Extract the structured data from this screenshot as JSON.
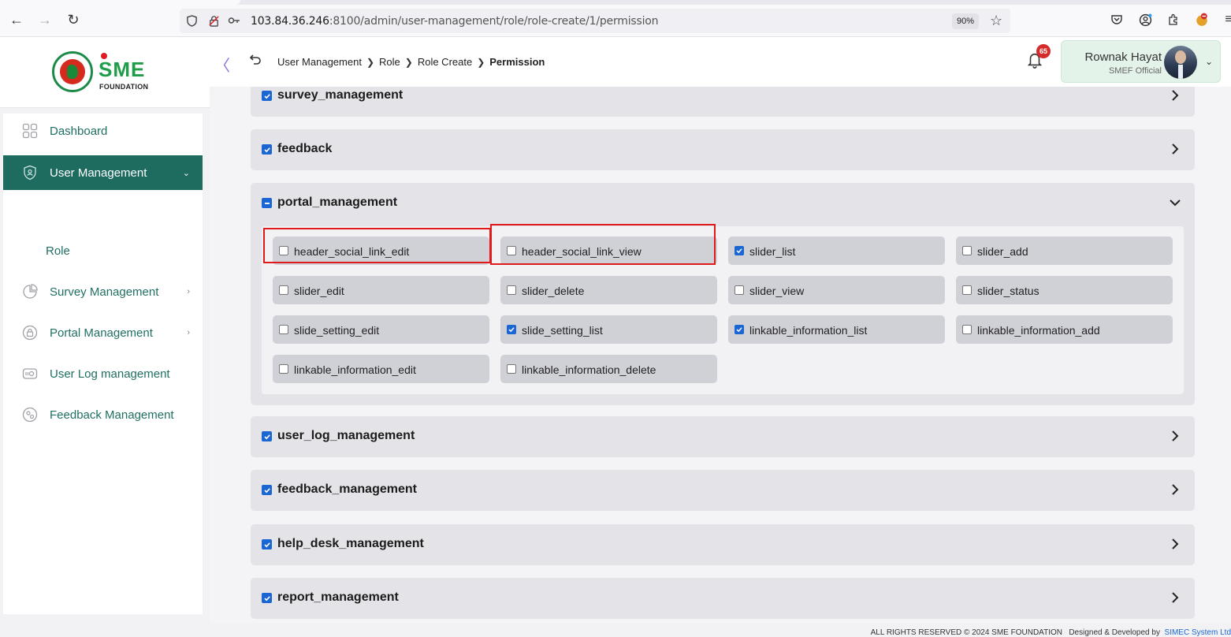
{
  "browser": {
    "url_host": "103.84.36.246",
    "url_rest": ":8100/admin/user-management/role/role-create/1/permission",
    "zoom": "90%"
  },
  "logo": {
    "brand": "SME",
    "subtitle": "FOUNDATION"
  },
  "sidebar": {
    "items": [
      {
        "label": "Dashboard",
        "icon": "grid-icon"
      },
      {
        "label": "User Management",
        "icon": "shield-user-icon",
        "active": true
      },
      {
        "label": "Survey Management",
        "icon": "pie-chart-icon"
      },
      {
        "label": "Portal Management",
        "icon": "lock-icon"
      },
      {
        "label": "User Log management",
        "icon": "log-icon"
      },
      {
        "label": "Feedback Management",
        "icon": "feedback-icon"
      }
    ],
    "sub_item": "Role"
  },
  "header": {
    "breadcrumb": [
      "User Management",
      "Role",
      "Role Create",
      "Permission"
    ],
    "notification_count": "65",
    "user_name": "Rownak Hayat",
    "user_role": "SMEF Official"
  },
  "sections": {
    "survey": {
      "title": "survey_management"
    },
    "feedback": {
      "title": "feedback"
    },
    "portal": {
      "title": "portal_management"
    },
    "user_log": {
      "title": "user_log_management"
    },
    "feedback_mgmt": {
      "title": "feedback_management"
    },
    "help_desk": {
      "title": "help_desk_management"
    },
    "report": {
      "title": "report_management"
    }
  },
  "portal_permissions": [
    {
      "label": "header_social_link_edit",
      "checked": false
    },
    {
      "label": "header_social_link_view",
      "checked": false
    },
    {
      "label": "slider_list",
      "checked": true
    },
    {
      "label": "slider_add",
      "checked": false
    },
    {
      "label": "slider_edit",
      "checked": false
    },
    {
      "label": "slider_delete",
      "checked": false
    },
    {
      "label": "slider_view",
      "checked": false
    },
    {
      "label": "slider_status",
      "checked": false
    },
    {
      "label": "slide_setting_edit",
      "checked": false
    },
    {
      "label": "slide_setting_list",
      "checked": true
    },
    {
      "label": "linkable_information_list",
      "checked": true
    },
    {
      "label": "linkable_information_add",
      "checked": false
    },
    {
      "label": "linkable_information_edit",
      "checked": false
    },
    {
      "label": "linkable_information_delete",
      "checked": false
    }
  ],
  "footer": {
    "rights": "ALL RIGHTS RESERVED © 2024 SME FOUNDATION",
    "designed": "Designed & Developed by",
    "developer": "SIMEC System Ltd"
  },
  "colors": {
    "brand_green": "#1e6b5f",
    "checkbox_blue": "#1a66d2",
    "highlight_red": "#e01a1a",
    "badge_red": "#d62b2b"
  }
}
